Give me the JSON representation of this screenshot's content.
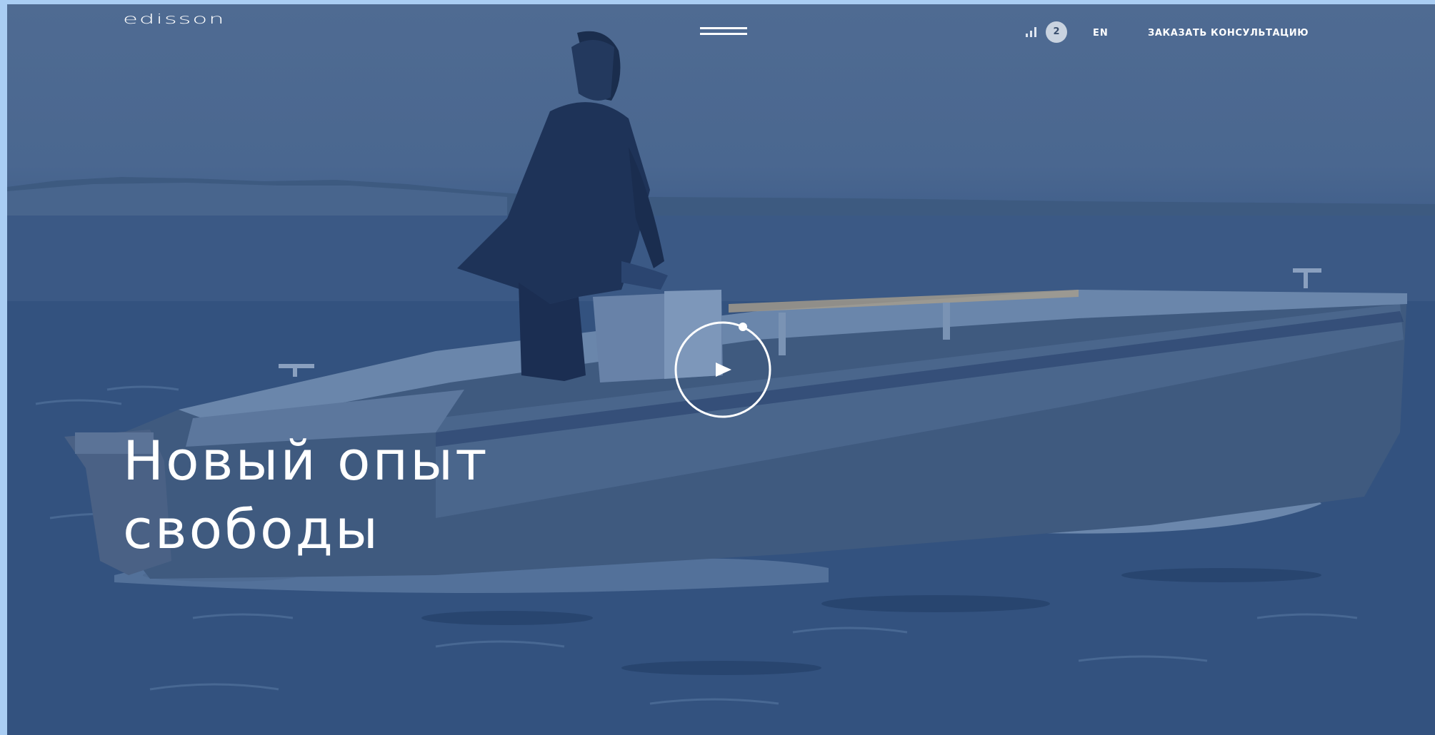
{
  "header": {
    "logo": "edisson",
    "menu_icon": "hamburger-icon",
    "compare": {
      "icon": "bar-chart-icon",
      "count": "2"
    },
    "language": "EN",
    "cta_label": "ЗАКАЗАТЬ КОНСУЛЬТАЦИЮ"
  },
  "hero": {
    "title_line1": "Новый опыт",
    "title_line2": "свободы",
    "play_icon": "play-icon"
  },
  "colors": {
    "page_frame": "#a9cdf3",
    "overlay_blue": "#34527f",
    "text": "#ffffff"
  }
}
